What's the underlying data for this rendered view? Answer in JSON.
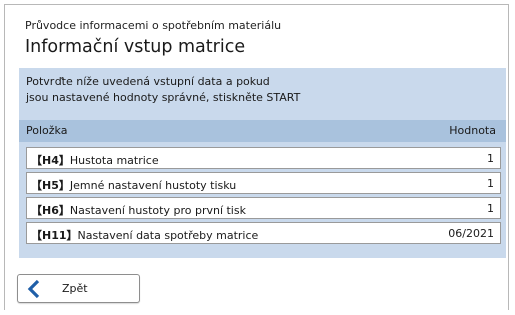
{
  "header": {
    "subtitle": "Průvodce informacemi o spotřebním materiálu",
    "title": "Informační vstup matrice"
  },
  "instruction": {
    "line1": "Potvrďte níže uvedená vstupní data a pokud",
    "line2": "jsou nastavené hodnoty správné, stiskněte START"
  },
  "table": {
    "col_item": "Položka",
    "col_value": "Hodnota",
    "rows": [
      {
        "code": "【H4】",
        "label": "Hustota matrice",
        "value": "1"
      },
      {
        "code": "【H5】",
        "label": "Jemné nastavení hustoty tisku",
        "value": "1"
      },
      {
        "code": "【H6】",
        "label": "Nastavení hustoty pro první tisk",
        "value": "1"
      },
      {
        "code": "【H11】",
        "label": "Nastavení data spotřeby matrice",
        "value": "06/2021"
      }
    ]
  },
  "footer": {
    "back_label": "Zpět",
    "back_icon": "chevron-left-icon"
  },
  "colors": {
    "panel_bg": "#c9d9ec",
    "table_header_bg": "#a9c2dd",
    "icon_blue": "#1f5fa8"
  }
}
